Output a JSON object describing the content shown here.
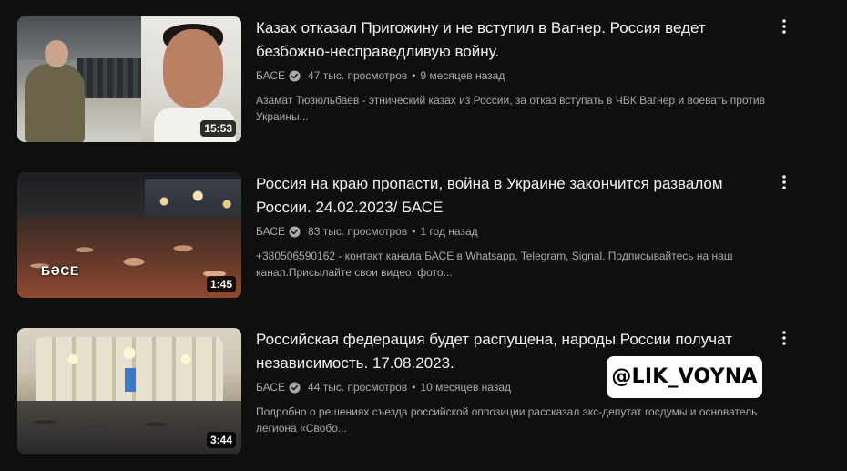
{
  "videos": [
    {
      "title": "Казах отказал Пригожину и не вступил в Вагнер. Россия ведет безбожно-несправедливую войну.",
      "channel": "БАСЕ",
      "views": "47 тыс. просмотров",
      "age": "9 месяцев назад",
      "description": "Азамат Тюзюльбаев - этнический казах из России, за отказ вступать в ЧВК Вагнер и воевать против Украины...",
      "duration": "15:53",
      "thumbnail_overlay": ""
    },
    {
      "title": "Россия на краю пропасти, война в Украине закончится развалом России. 24.02.2023/ БАСЕ",
      "channel": "БАСЕ",
      "views": "83 тыс. просмотров",
      "age": "1 год назад",
      "description": "+380506590162 - контакт канала БАСЕ в Whatsapp, Telegram, Signal. Подписывайтесь на наш канал.Присылайте свои видео, фото...",
      "duration": "1:45",
      "thumbnail_overlay": "БӘСЕ"
    },
    {
      "title": "Российская федерация будет распущена, народы России получат независимость. 17.08.2023.",
      "channel": "БАСЕ",
      "views": "44 тыс. просмотров",
      "age": "10 месяцев назад",
      "description": "Подробно о решениях съезда российской оппозиции рассказал экс-депутат госдумы и основатель легиона «Свобо...",
      "duration": "3:44",
      "thumbnail_overlay": ""
    }
  ],
  "separator": "•",
  "watermark": "@LIK_VOYNA",
  "icons": {
    "verified": "verified-check-icon",
    "menu": "more-vert-icon"
  },
  "colors": {
    "background": "#0f0f0f",
    "title": "#f1f1f1",
    "meta": "#aaaaaa"
  }
}
